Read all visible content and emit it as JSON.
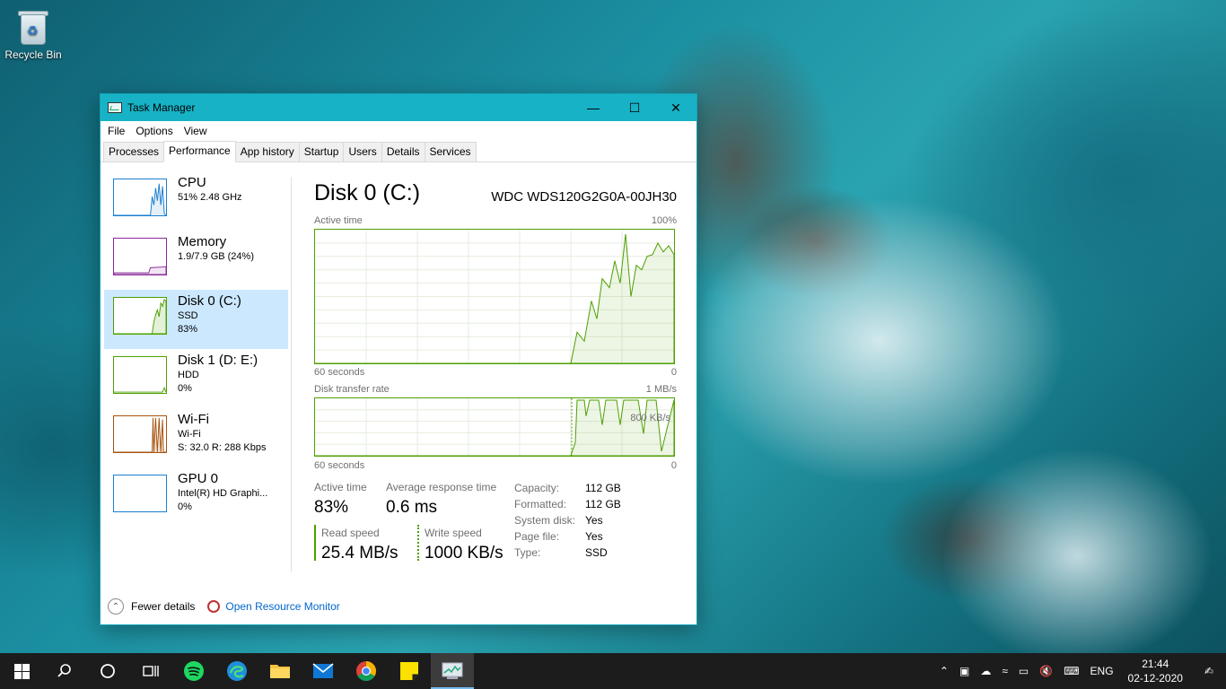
{
  "desktop": {
    "recycle_bin": "Recycle Bin"
  },
  "window": {
    "title": "Task Manager",
    "menu": [
      "File",
      "Options",
      "View"
    ],
    "tabs": [
      "Processes",
      "Performance",
      "App history",
      "Startup",
      "Users",
      "Details",
      "Services"
    ],
    "active_tab": "Performance"
  },
  "sidebar": [
    {
      "name": "CPU",
      "line1": "51% 2.48 GHz",
      "line2": "",
      "color": "#1a7ed0"
    },
    {
      "name": "Memory",
      "line1": "1.9/7.9 GB (24%)",
      "line2": "",
      "color": "#8a2a9a"
    },
    {
      "name": "Disk 0 (C:)",
      "line1": "SSD",
      "line2": "83%",
      "color": "#4da000"
    },
    {
      "name": "Disk 1 (D: E:)",
      "line1": "HDD",
      "line2": "0%",
      "color": "#4da000"
    },
    {
      "name": "Wi-Fi",
      "line1": "Wi-Fi",
      "line2": "S: 32.0  R: 288 Kbps",
      "color": "#a7530f"
    },
    {
      "name": "GPU 0",
      "line1": "Intel(R) HD Graphi...",
      "line2": "0%",
      "color": "#1a7ed0"
    }
  ],
  "detail": {
    "title": "Disk 0 (C:)",
    "model": "WDC WDS120G2G0A-00JH30",
    "graph1": {
      "label": "Active time",
      "max": "100%",
      "xlabel": "60 seconds",
      "xmin": "0"
    },
    "graph2": {
      "label": "Disk transfer rate",
      "max": "1 MB/s",
      "mid": "800 KB/s",
      "xlabel": "60 seconds",
      "xmin": "0"
    },
    "active_time_label": "Active time",
    "active_time_value": "83%",
    "avg_resp_label": "Average response time",
    "avg_resp_value": "0.6 ms",
    "read_label": "Read speed",
    "read_value": "25.4 MB/s",
    "write_label": "Write speed",
    "write_value": "1000 KB/s",
    "props": [
      {
        "k": "Capacity:",
        "v": "112 GB"
      },
      {
        "k": "Formatted:",
        "v": "112 GB"
      },
      {
        "k": "System disk:",
        "v": "Yes"
      },
      {
        "k": "Page file:",
        "v": "Yes"
      },
      {
        "k": "Type:",
        "v": "SSD"
      }
    ]
  },
  "footer": {
    "fewer": "Fewer details",
    "resource": "Open Resource Monitor"
  },
  "taskbar": {
    "lang": "ENG",
    "time": "21:44",
    "date": "02-12-2020"
  }
}
